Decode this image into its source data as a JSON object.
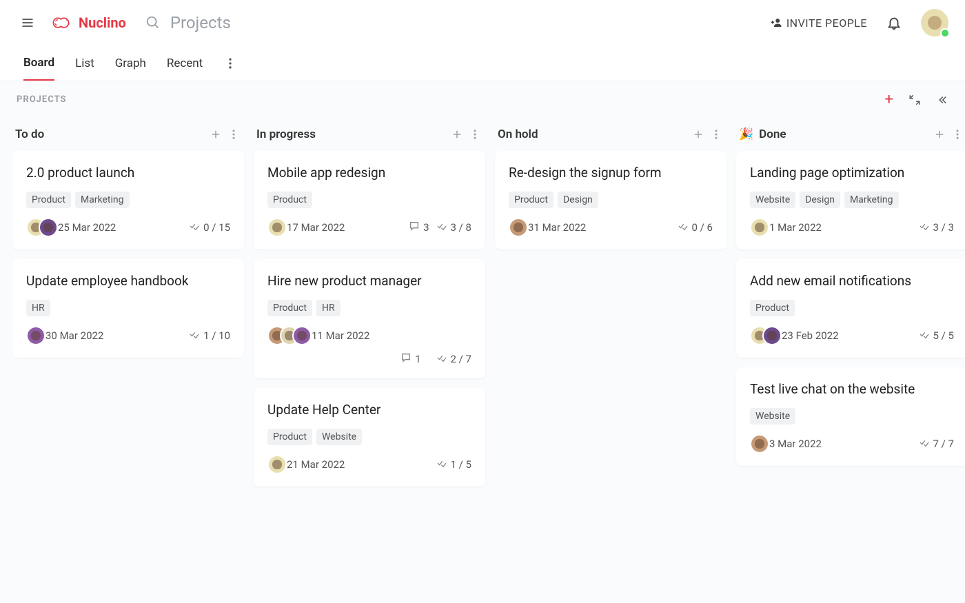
{
  "header": {
    "app_name": "Nuclino",
    "search_placeholder": "Projects",
    "invite_label": "INVITE PEOPLE"
  },
  "tabs": [
    "Board",
    "List",
    "Graph",
    "Recent"
  ],
  "active_tab": "Board",
  "breadcrumb": "PROJECTS",
  "columns": [
    {
      "title": "To do",
      "emoji": "",
      "cards": [
        {
          "title": "2.0 product launch",
          "tags": [
            "Product",
            "Marketing"
          ],
          "avatars": [
            "c1",
            "c2"
          ],
          "date": "25 Mar 2022",
          "comments": null,
          "tasks": "0 / 15",
          "wrap_stats": false
        },
        {
          "title": "Update employee handbook",
          "tags": [
            "HR"
          ],
          "avatars": [
            "c5"
          ],
          "date": "30 Mar 2022",
          "comments": null,
          "tasks": "1 / 10",
          "wrap_stats": false
        }
      ]
    },
    {
      "title": "In progress",
      "emoji": "",
      "cards": [
        {
          "title": "Mobile app redesign",
          "tags": [
            "Product"
          ],
          "avatars": [
            "c1"
          ],
          "date": "17 Mar 2022",
          "comments": "3",
          "tasks": "3 / 8",
          "wrap_stats": false
        },
        {
          "title": "Hire new product manager",
          "tags": [
            "Product",
            "HR"
          ],
          "avatars": [
            "c3",
            "c4",
            "c5"
          ],
          "date": "11 Mar 2022",
          "comments": "1",
          "tasks": "2 / 7",
          "wrap_stats": true
        },
        {
          "title": "Update Help Center",
          "tags": [
            "Product",
            "Website"
          ],
          "avatars": [
            "c1"
          ],
          "date": "21 Mar 2022",
          "comments": null,
          "tasks": "1 / 5",
          "wrap_stats": false
        }
      ]
    },
    {
      "title": "On hold",
      "emoji": "",
      "cards": [
        {
          "title": "Re-design the signup form",
          "tags": [
            "Product",
            "Design"
          ],
          "avatars": [
            "c3"
          ],
          "date": "31 Mar 2022",
          "comments": null,
          "tasks": "0 / 6",
          "wrap_stats": false
        }
      ]
    },
    {
      "title": "Done",
      "emoji": "🎉",
      "cards": [
        {
          "title": "Landing page optimization",
          "tags": [
            "Website",
            "Design",
            "Marketing"
          ],
          "avatars": [
            "c1"
          ],
          "date": "1 Mar 2022",
          "comments": null,
          "tasks": "3 / 3",
          "wrap_stats": false
        },
        {
          "title": "Add new email notifications",
          "tags": [
            "Product"
          ],
          "avatars": [
            "c1",
            "c2"
          ],
          "date": "23 Feb 2022",
          "comments": null,
          "tasks": "5 / 5",
          "wrap_stats": false
        },
        {
          "title": "Test live chat on the website",
          "tags": [
            "Website"
          ],
          "avatars": [
            "c3"
          ],
          "date": "3 Mar 2022",
          "comments": null,
          "tasks": "7 / 7",
          "wrap_stats": false
        }
      ]
    }
  ]
}
